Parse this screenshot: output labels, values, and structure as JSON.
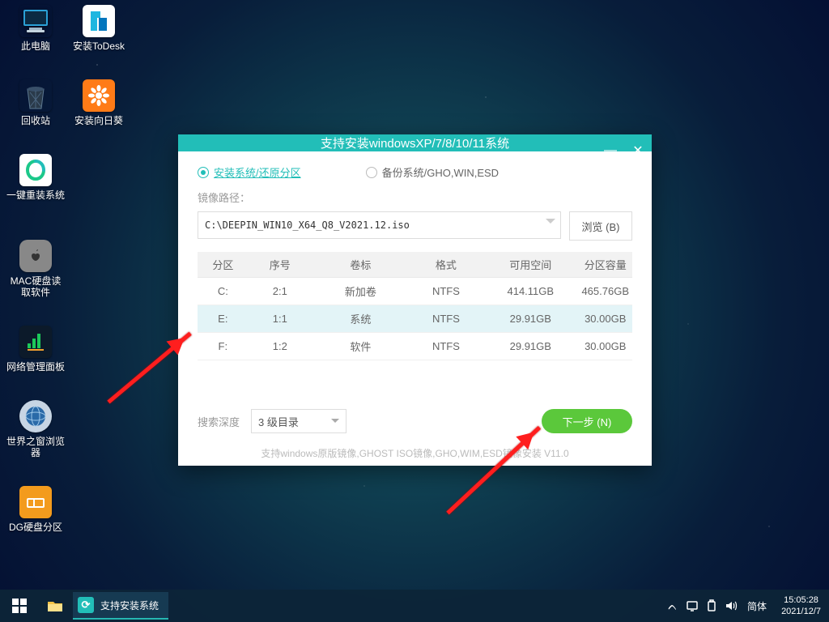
{
  "desktop_icons": [
    {
      "id": "pc",
      "label": "此电脑"
    },
    {
      "id": "todesk",
      "label": "安装ToDesk"
    },
    {
      "id": "recycle",
      "label": "回收站"
    },
    {
      "id": "sunflower",
      "label": "安装向日葵"
    },
    {
      "id": "onekey",
      "label": "一键重装系统"
    },
    {
      "id": "macdisk",
      "label": "MAC硬盘读取软件"
    },
    {
      "id": "netpanel",
      "label": "网络管理面板"
    },
    {
      "id": "browser",
      "label": "世界之窗浏览器"
    },
    {
      "id": "dg",
      "label": "DG硬盘分区"
    }
  ],
  "window": {
    "title": "支持安装windowsXP/7/8/10/11系统",
    "radio_install": "安装系统/还原分区",
    "radio_backup": "备份系统/GHO,WIN,ESD",
    "image_path_label": "镜像路径：",
    "image_path": "C:\\DEEPIN_WIN10_X64_Q8_V2021.12.iso",
    "browse": "浏览 (B)",
    "columns": {
      "part": "分区",
      "index": "序号",
      "vol": "卷标",
      "fs": "格式",
      "free": "可用空间",
      "total": "分区容量"
    },
    "rows": [
      {
        "part": "C:",
        "index": "2:1",
        "vol": "新加卷",
        "fs": "NTFS",
        "free": "414.11GB",
        "total": "465.76GB"
      },
      {
        "part": "E:",
        "index": "1:1",
        "vol": "系统",
        "fs": "NTFS",
        "free": "29.91GB",
        "total": "30.00GB"
      },
      {
        "part": "F:",
        "index": "1:2",
        "vol": "软件",
        "fs": "NTFS",
        "free": "29.91GB",
        "total": "30.00GB"
      }
    ],
    "depth_label": "搜索深度",
    "depth_value": "3 级目录",
    "next": "下一步 (N)",
    "hint": "支持windows原版镜像,GHOST ISO镜像,GHO,WIM,ESD镜像安装 V11.0"
  },
  "taskbar": {
    "task_label": "支持安装系统",
    "ime": "简体",
    "time": "15:05:28",
    "date": "2021/12/7",
    "chevron": "ᨈ"
  }
}
